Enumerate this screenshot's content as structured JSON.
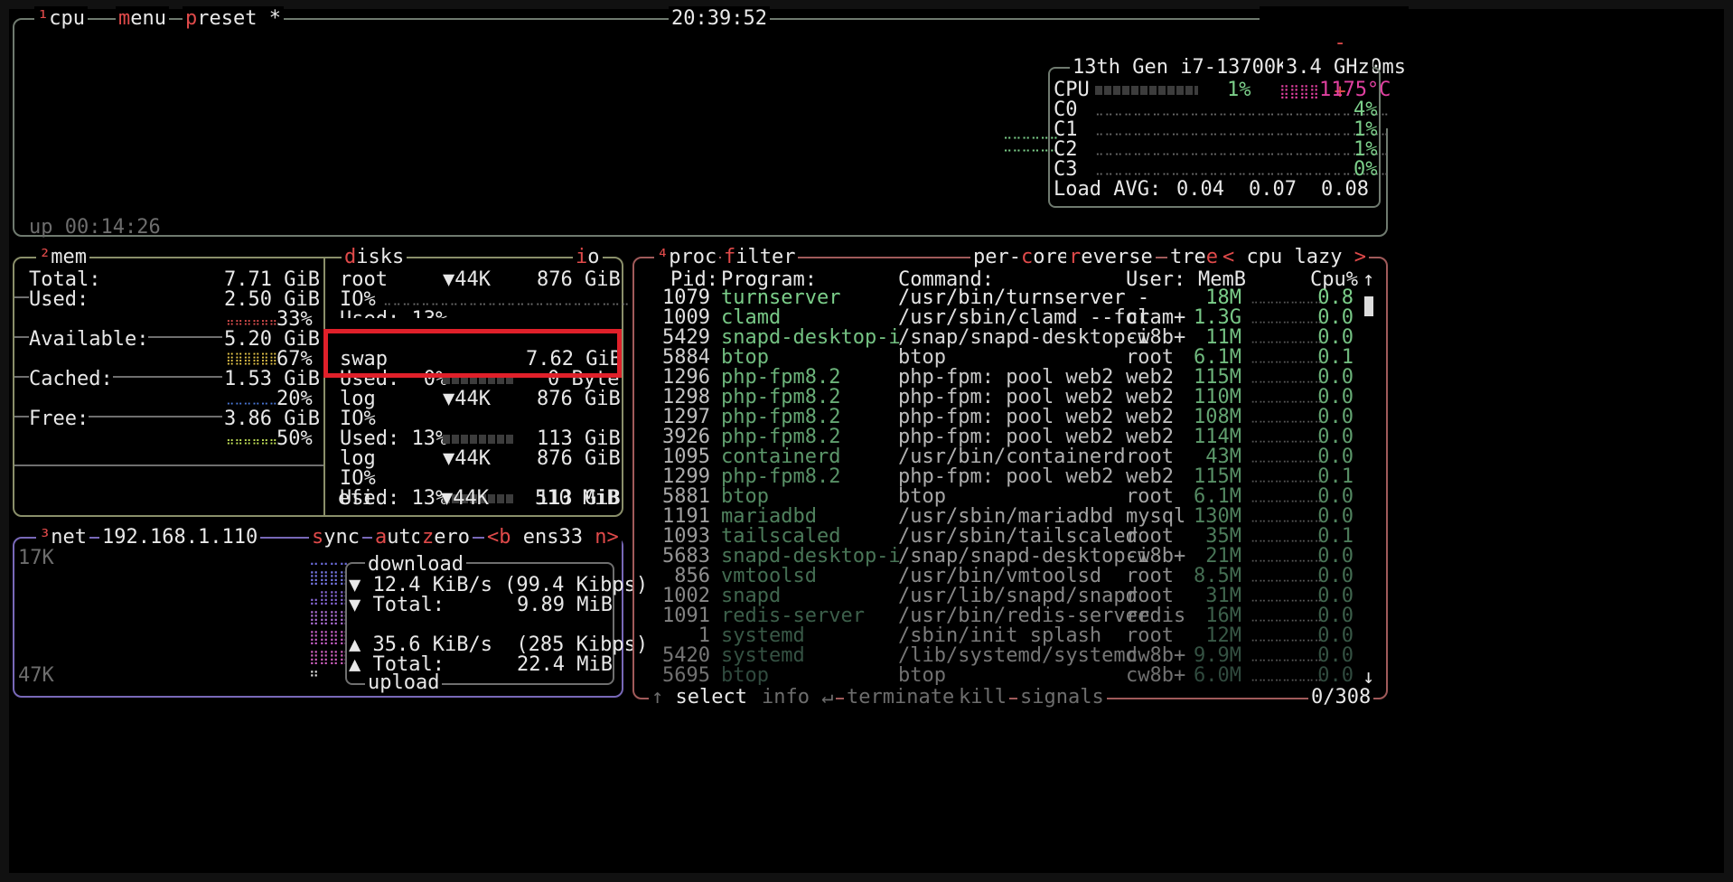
{
  "header": {
    "cpu_tab": "cpu",
    "cpu_num": "¹",
    "menu": "menu",
    "preset": "preset *",
    "clock": "20:39:52",
    "minus": "-",
    "interval": "2000ms",
    "plus": "+"
  },
  "cpu": {
    "model": "13th Gen i7-13700K",
    "freq": "3.4 GHz",
    "total_label": "CPU",
    "total_pct": "1%",
    "temp": "1175°C",
    "cores": [
      {
        "label": "C0",
        "pct": "4%"
      },
      {
        "label": "C1",
        "pct": "1%"
      },
      {
        "label": "C2",
        "pct": "1%"
      },
      {
        "label": "C3",
        "pct": "0%"
      }
    ],
    "load_label": "Load AVG:",
    "load": [
      "0.04",
      "0.07",
      "0.08"
    ],
    "uptime": "up 00:14:26"
  },
  "mem": {
    "title": "mem",
    "num": "²",
    "total_label": "Total:",
    "total": "7.71 GiB",
    "rows": [
      {
        "label": "Used:",
        "value": "2.50 GiB",
        "pct": "33%",
        "color": "#e05050"
      },
      {
        "label": "Available:",
        "value": "5.20 GiB",
        "pct": "67%",
        "color": "#e8c84a"
      },
      {
        "label": "Cached:",
        "value": "1.53 GiB",
        "pct": "20%",
        "color": "#4a78d8"
      },
      {
        "label": "Free:",
        "value": "3.86 GiB",
        "pct": "50%",
        "color": "#c8e85a"
      }
    ]
  },
  "disks": {
    "title": "disks",
    "io_tab": "io",
    "root": {
      "name": "root",
      "speed": "▼44K",
      "size": "876 GiB",
      "io": "IO%",
      "used": "Used: 13%",
      "used_size": "113 GiB"
    },
    "swap": {
      "name": "swap",
      "size": "7.62 GiB",
      "used": "Used:  0%",
      "used_size": "0 Byte"
    },
    "log1": {
      "name": "log",
      "speed": "▼44K",
      "size": "876 GiB",
      "io": "IO%",
      "used": "Used: 13%",
      "used_size": "113 GiB"
    },
    "log2": {
      "name": "log",
      "speed": "▼44K",
      "size": "876 GiB",
      "io": "IO%",
      "used": "Used: 13%",
      "used_size": "113 GiB"
    },
    "efi": {
      "name": "efi",
      "speed": "▼44K",
      "size": "510 MiB"
    }
  },
  "net": {
    "title": "net",
    "num": "³",
    "ip": "192.168.1.110",
    "sync": "sync",
    "auto": "auto",
    "zero": "zero",
    "iface_prev": "<b",
    "iface": "ens33",
    "iface_next": "n>",
    "scale_top": "17K",
    "scale_bottom": "47K",
    "download_label": "download",
    "down_rate": "▼ 12.4 KiB/s (99.4 Kibps)",
    "down_total_label": "▼ Total:",
    "down_total": "9.89 MiB",
    "up_rate": "▲ 35.6 KiB/s  (285 Kibps)",
    "up_total_label": "▲ Total:",
    "up_total": "22.4 MiB",
    "upload_label": "upload"
  },
  "proc": {
    "title": "proc",
    "num": "⁴",
    "filter": "filter",
    "per_core": "per-core",
    "reverse": "reverse",
    "tree": "tree",
    "sort_prev": "<",
    "sort": "cpu lazy",
    "sort_next": ">",
    "columns": {
      "pid": "Pid:",
      "program": "Program:",
      "command": "Command:",
      "user": "User:",
      "mem": "MemB",
      "cpu": "Cpu%"
    },
    "rows": [
      {
        "pid": "1079",
        "program": "turnserver",
        "command": "/usr/bin/turnserver -",
        "user": "",
        "mem": "18M",
        "cpu": "0.8"
      },
      {
        "pid": "1009",
        "program": "clamd",
        "command": "/usr/sbin/clamd --for",
        "user": "clam+",
        "mem": "1.3G",
        "cpu": "0.0"
      },
      {
        "pid": "5429",
        "program": "snapd-desktop-i",
        "command": "/snap/snapd-desktop-i",
        "user": "cw8b+",
        "mem": "11M",
        "cpu": "0.0"
      },
      {
        "pid": "5884",
        "program": "btop",
        "command": "btop",
        "user": "root",
        "mem": "6.1M",
        "cpu": "0.1"
      },
      {
        "pid": "1296",
        "program": "php-fpm8.2",
        "command": "php-fpm: pool web2",
        "user": "web2",
        "mem": "115M",
        "cpu": "0.0"
      },
      {
        "pid": "1298",
        "program": "php-fpm8.2",
        "command": "php-fpm: pool web2",
        "user": "web2",
        "mem": "110M",
        "cpu": "0.0"
      },
      {
        "pid": "1297",
        "program": "php-fpm8.2",
        "command": "php-fpm: pool web2",
        "user": "web2",
        "mem": "108M",
        "cpu": "0.0"
      },
      {
        "pid": "3926",
        "program": "php-fpm8.2",
        "command": "php-fpm: pool web2",
        "user": "web2",
        "mem": "114M",
        "cpu": "0.0"
      },
      {
        "pid": "1095",
        "program": "containerd",
        "command": "/usr/bin/containerd",
        "user": "root",
        "mem": "43M",
        "cpu": "0.0"
      },
      {
        "pid": "1299",
        "program": "php-fpm8.2",
        "command": "php-fpm: pool web2",
        "user": "web2",
        "mem": "115M",
        "cpu": "0.1"
      },
      {
        "pid": "5881",
        "program": "btop",
        "command": "btop",
        "user": "root",
        "mem": "6.1M",
        "cpu": "0.0"
      },
      {
        "pid": "1191",
        "program": "mariadbd",
        "command": "/usr/sbin/mariadbd",
        "user": "mysql",
        "mem": "130M",
        "cpu": "0.0"
      },
      {
        "pid": "1093",
        "program": "tailscaled",
        "command": "/usr/sbin/tailscaled",
        "user": "root",
        "mem": "35M",
        "cpu": "0.1"
      },
      {
        "pid": "5683",
        "program": "snapd-desktop-i",
        "command": "/snap/snapd-desktop-i",
        "user": "cw8b+",
        "mem": "21M",
        "cpu": "0.0"
      },
      {
        "pid": "856",
        "program": "vmtoolsd",
        "command": "/usr/bin/vmtoolsd",
        "user": "root",
        "mem": "8.5M",
        "cpu": "0.0"
      },
      {
        "pid": "1002",
        "program": "snapd",
        "command": "/usr/lib/snapd/snapd",
        "user": "root",
        "mem": "31M",
        "cpu": "0.0"
      },
      {
        "pid": "1091",
        "program": "redis-server",
        "command": "/usr/bin/redis-server",
        "user": "redis",
        "mem": "16M",
        "cpu": "0.0"
      },
      {
        "pid": "1",
        "program": "systemd",
        "command": "/sbin/init splash",
        "user": "root",
        "mem": "12M",
        "cpu": "0.0"
      },
      {
        "pid": "5420",
        "program": "systemd",
        "command": "/lib/systemd/systemd",
        "user": "cw8b+",
        "mem": "9.9M",
        "cpu": "0.0"
      },
      {
        "pid": "5695",
        "program": "btop",
        "command": "btop",
        "user": "cw8b+",
        "mem": "6.0M",
        "cpu": "0.0"
      }
    ],
    "footer": {
      "select": "select",
      "info": "info",
      "terminate": "terminate",
      "kill": "kill",
      "signals": "signals",
      "count": "0/308"
    }
  },
  "colors": {
    "cpu_box": "#6f7a6f",
    "mem_box": "#8a8f6a",
    "net_box": "#7868b8",
    "proc_box": "#a05a5a",
    "highlight": "#e0202a",
    "hotkey": "#e05050",
    "program": "#7ccf8a"
  }
}
